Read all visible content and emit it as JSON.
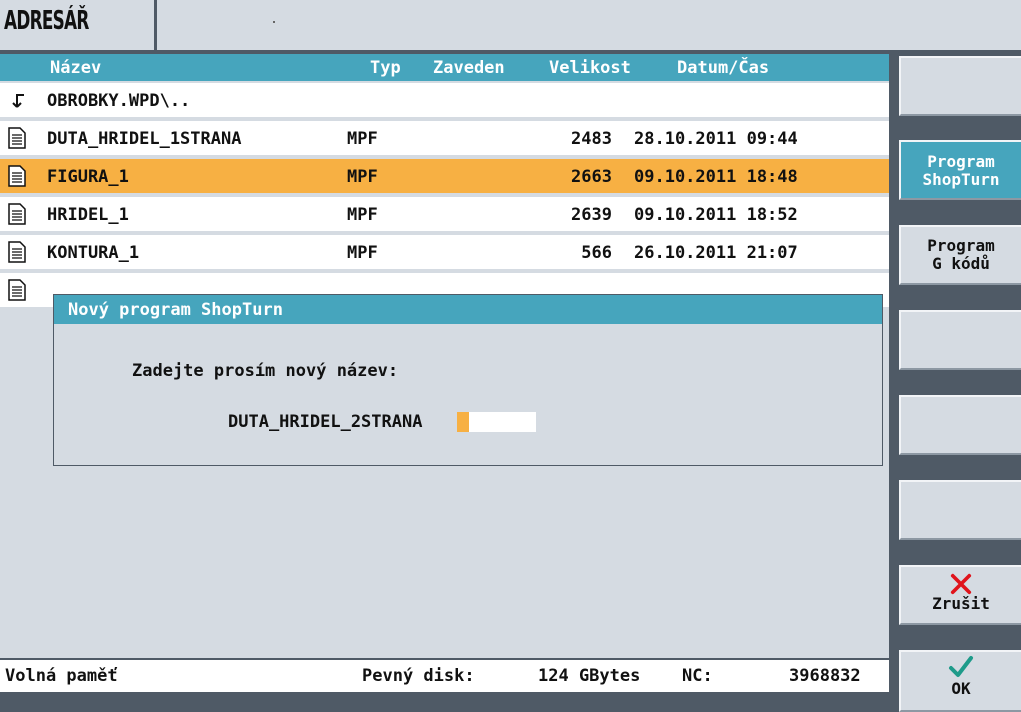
{
  "window": {
    "title": "ADRESÁŘ"
  },
  "columns": {
    "name": "Název",
    "type": "Typ",
    "loaded": "Zaveden",
    "size": "Velikost",
    "datetime": "Datum/Čas"
  },
  "rows": [
    {
      "icon": "folder-up-icon",
      "name": "OBROBKY.WPD\\..",
      "type": "",
      "size": "",
      "date": ""
    },
    {
      "icon": "document-icon",
      "name": "DUTA_HRIDEL_1STRANA",
      "type": "MPF",
      "size": "2483",
      "date": "28.10.2011 09:44"
    },
    {
      "icon": "document-icon",
      "name": "FIGURA_1",
      "type": "MPF",
      "size": "2663",
      "date": "09.10.2011 18:48",
      "selected": true
    },
    {
      "icon": "document-icon",
      "name": "HRIDEL_1",
      "type": "MPF",
      "size": "2639",
      "date": "09.10.2011 18:52"
    },
    {
      "icon": "document-icon",
      "name": "KONTURA_1",
      "type": "MPF",
      "size": "566",
      "date": "26.10.2011 21:07"
    }
  ],
  "status": {
    "free_memory_label": "Volná paměť",
    "hard_disk_label": "Pevný disk:",
    "hard_disk_value": "124 GBytes",
    "nc_label": "NC:",
    "nc_value": "3968832"
  },
  "dialog": {
    "title": "Nový program ShopTurn",
    "prompt": "Zadejte prosím nový název:",
    "input_value": "DUTA_HRIDEL_2STRANA"
  },
  "softkeys": {
    "k1": "",
    "k2": "Program\nShopTurn",
    "k3": "Program\nG kódů",
    "k4": "",
    "k5": "",
    "k6": "",
    "cancel": "Zrušit",
    "ok": "OK"
  },
  "colors": {
    "accent": "#46a5bd",
    "selection": "#f7b043",
    "background": "#d5dbe2",
    "frame": "#4f5a66"
  }
}
